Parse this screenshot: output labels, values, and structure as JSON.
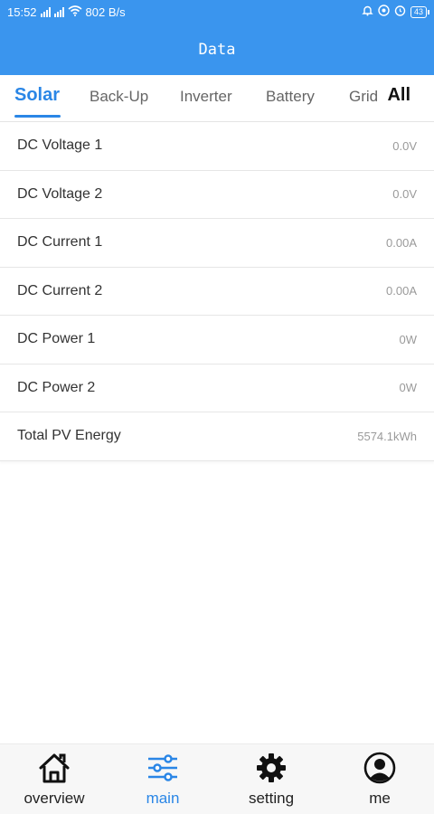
{
  "status_bar": {
    "time": "15:52",
    "network_speed": "802 B/s",
    "battery": "43"
  },
  "app_bar": {
    "title": "Data"
  },
  "tabs": [
    {
      "label": "Solar",
      "active": true
    },
    {
      "label": "Back-Up",
      "active": false
    },
    {
      "label": "Inverter",
      "active": false
    },
    {
      "label": "Battery",
      "active": false
    },
    {
      "label": "Grid",
      "active": false
    }
  ],
  "tab_all": "All",
  "rows": [
    {
      "label": "DC Voltage 1",
      "value": "0.0V"
    },
    {
      "label": "DC Voltage 2",
      "value": "0.0V"
    },
    {
      "label": "DC Current 1",
      "value": "0.00A"
    },
    {
      "label": "DC Current 2",
      "value": "0.00A"
    },
    {
      "label": "DC Power 1",
      "value": "0W"
    },
    {
      "label": "DC Power 2",
      "value": "0W"
    },
    {
      "label": "Total PV Energy",
      "value": "5574.1kWh"
    }
  ],
  "bottom_nav": [
    {
      "label": "overview",
      "icon": "home-icon",
      "active": false
    },
    {
      "label": "main",
      "icon": "sliders-icon",
      "active": true
    },
    {
      "label": "setting",
      "icon": "gear-icon",
      "active": false
    },
    {
      "label": "me",
      "icon": "user-icon",
      "active": false
    }
  ],
  "colors": {
    "primary": "#3a95ee",
    "accent": "#2a86e6"
  }
}
